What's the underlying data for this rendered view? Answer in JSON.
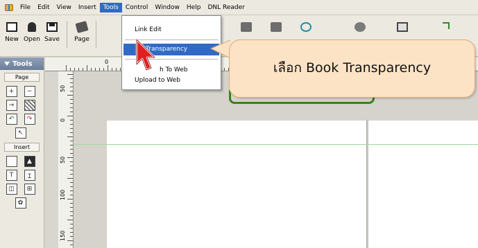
{
  "menubar": {
    "items": [
      "File",
      "Edit",
      "View",
      "Insert",
      "Tools",
      "Control",
      "Window",
      "Help",
      "DNL Reader"
    ],
    "active_index": 4
  },
  "toolbar": {
    "new_label": "New",
    "open_label": "Open",
    "save_label": "Save",
    "page_label": "Page"
  },
  "tools_menu": {
    "items": [
      "Link Edit",
      "Book Transparency",
      "Publish To Web",
      "Upload to Web"
    ],
    "partial_items": [
      "k Transparency",
      "h To Web"
    ],
    "highlighted_index": 1
  },
  "palette": {
    "title": "Tools",
    "section_page": "Page",
    "section_insert": "Insert"
  },
  "ruler": {
    "top_labels": [
      "0"
    ],
    "left_labels": [
      "50",
      "0",
      "50",
      "100",
      "150"
    ]
  },
  "callout": {
    "text": "เลือก Book Transparency"
  },
  "colors": {
    "menu_highlight": "#316ac5",
    "callout_fill": "#fde3c6",
    "callout_border": "#e0a878",
    "cursor_red": "#e02020",
    "guide_green": "#9fd9a0"
  }
}
